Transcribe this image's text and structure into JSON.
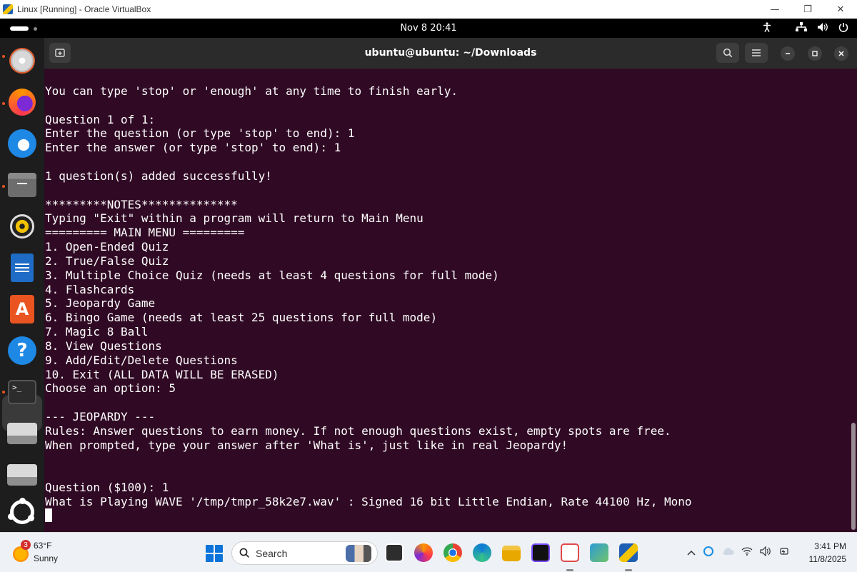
{
  "host_window": {
    "title": "Linux [Running] - Oracle VirtualBox",
    "minimize_glyph": "—",
    "restore_glyph": "❐",
    "close_glyph": "✕"
  },
  "gnome_topbar": {
    "clock": "Nov 8  20:41",
    "icons": [
      "accessibility-icon",
      "network-icon",
      "volume-icon",
      "power-icon"
    ]
  },
  "dock": {
    "apps": [
      "disk-utility",
      "firefox",
      "thunderbird",
      "files",
      "rhythmbox",
      "libreoffice-writer",
      "app-center",
      "help",
      "terminal",
      "drive-1",
      "drive-2",
      "ubuntu-show-apps"
    ],
    "active_app": "terminal",
    "terminal_glyph": ">_"
  },
  "terminal": {
    "title": "ubuntu@ubuntu: ~/Downloads",
    "lines": [
      "You can type 'stop' or 'enough' at any time to finish early.",
      "",
      "Question 1 of 1:",
      "Enter the question (or type 'stop' to end): 1",
      "Enter the answer (or type 'stop' to end): 1",
      "",
      "1 question(s) added successfully!",
      "",
      "*********NOTES**************",
      "Typing \"Exit\" within a program will return to Main Menu",
      "========= MAIN MENU =========",
      "1. Open-Ended Quiz",
      "2. True/False Quiz",
      "3. Multiple Choice Quiz (needs at least 4 questions for full mode)",
      "4. Flashcards",
      "5. Jeopardy Game",
      "6. Bingo Game (needs at least 25 questions for full mode)",
      "7. Magic 8 Ball",
      "8. View Questions",
      "9. Add/Edit/Delete Questions",
      "10. Exit (ALL DATA WILL BE ERASED)",
      "Choose an option: 5",
      "",
      "--- JEOPARDY ---",
      "Rules: Answer questions to earn money. If not enough questions exist, empty spots are free.",
      "When prompted, type your answer after 'What is', just like in real Jeopardy!",
      "",
      "",
      "Question ($100): 1",
      "What is Playing WAVE '/tmp/tmpr_58k2e7.wav' : Signed 16 bit Little Endian, Rate 44100 Hz, Mono"
    ]
  },
  "taskbar": {
    "weather_temp": "63°F",
    "weather_condition": "Sunny",
    "weather_badge": "3",
    "search_label": "Search",
    "time": "3:41 PM",
    "date": "11/8/2025",
    "apps": [
      "file-explorer",
      "firefox",
      "chrome",
      "edge",
      "folder",
      "intellij",
      "snipping-tool",
      "vs-code",
      "virtualbox"
    ]
  }
}
